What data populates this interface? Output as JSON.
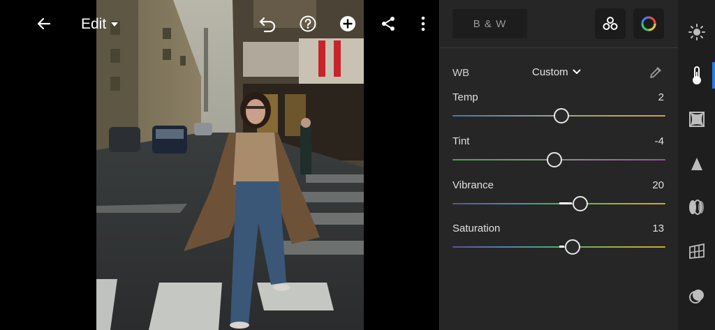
{
  "header": {
    "edit_label": "Edit",
    "icons": [
      "back-arrow-icon",
      "undo-icon",
      "help-icon",
      "add-icon",
      "share-icon",
      "more-icon"
    ]
  },
  "panel": {
    "bw_label": "B & W",
    "profile_icon": "profiles-icon",
    "color_mix_icon": "color-mix-icon",
    "wb": {
      "label": "WB",
      "value": "Custom",
      "picker_icon": "eyedropper-icon"
    },
    "sliders": [
      {
        "name": "Temp",
        "value": "2",
        "position": 0.51,
        "track": "temp"
      },
      {
        "name": "Tint",
        "value": "-4",
        "position": 0.48,
        "track": "tint"
      },
      {
        "name": "Vibrance",
        "value": "20",
        "position": 0.6,
        "track": "vibrance",
        "fill_from": 0.5
      },
      {
        "name": "Saturation",
        "value": "13",
        "position": 0.565,
        "track": "saturation",
        "fill_from": 0.5
      }
    ]
  },
  "rail": {
    "items": [
      "light-icon",
      "color-temp-icon",
      "effects-icon",
      "detail-icon",
      "optics-icon",
      "geometry-icon",
      "masking-icon"
    ],
    "active_index": 1
  },
  "colors": {
    "panel_bg": "#262626",
    "rail_bg": "#1e1e1e",
    "accent": "#2b7be4"
  }
}
